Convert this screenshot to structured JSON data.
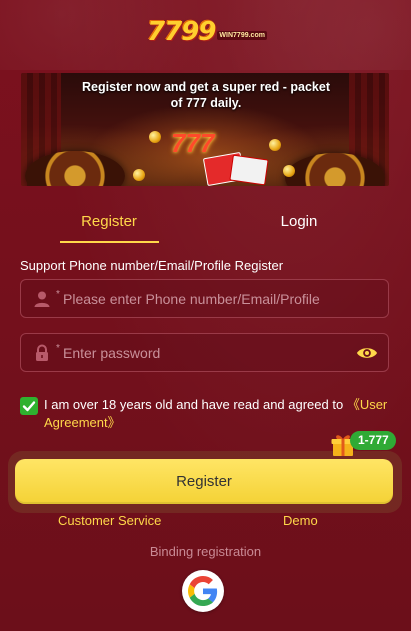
{
  "brand": {
    "logo_main": "7799",
    "logo_sub": "WIN7799.com"
  },
  "banner": {
    "headline": "Register now and get a super red - packet of 777 daily.",
    "graphic_text": "777"
  },
  "tabs": {
    "register": "Register",
    "login": "Login",
    "active": "register"
  },
  "form": {
    "section_label": "Support Phone number/Email/Profile Register",
    "phone_placeholder": "Please enter Phone number/Email/Profile",
    "password_placeholder": "Enter password",
    "required_mark": "*",
    "agree_checked": true,
    "agree_text": "I am over 18 years old and have read and agreed to ",
    "agree_link": "《User Agreement》"
  },
  "actions": {
    "register_button": "Register",
    "bonus_badge": "1-777",
    "customer_service": "Customer Service",
    "demo": "Demo",
    "binding_label": "Binding registration"
  },
  "icons": {
    "user": "user-icon",
    "lock": "lock-icon",
    "eye": "eye-icon",
    "check": "check-icon",
    "gift": "gift-icon",
    "google": "google-icon"
  },
  "colors": {
    "background": "#6f0f1b",
    "accent": "#ffd84a",
    "button": "#f4d235",
    "badge": "#2faa35",
    "checkbox": "#2fb12f"
  }
}
